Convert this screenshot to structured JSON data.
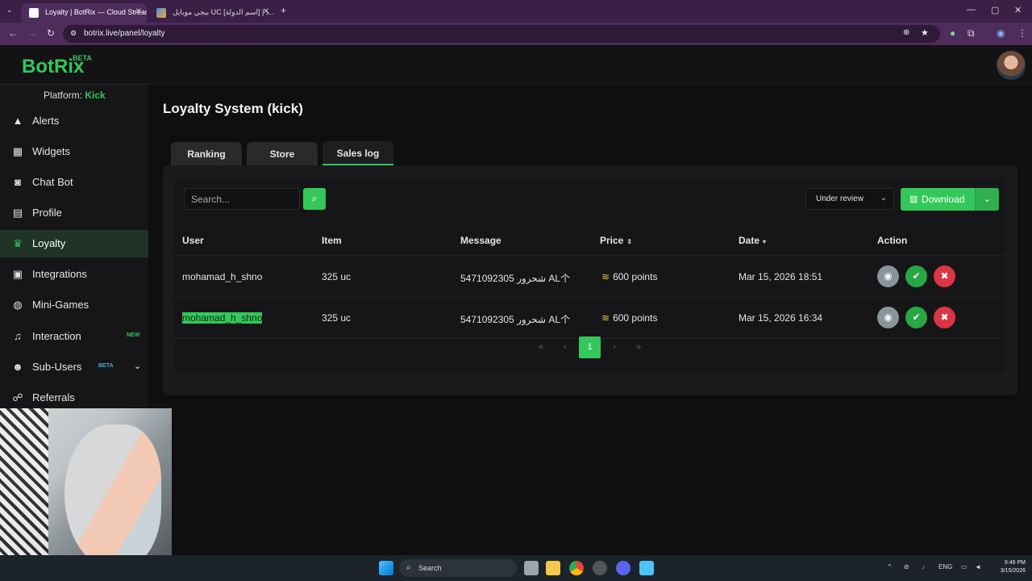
{
  "browser": {
    "tabs": [
      {
        "title": "Loyalty | BotRix — Cloud Stream"
      },
      {
        "title": "ببجي موبايل UC [اسم الدولة] | د..."
      }
    ],
    "url": "botrix.live/panel/loyalty"
  },
  "app": {
    "logo": "BotRix",
    "logo_badge": "BETA",
    "platform_label": "Platform:",
    "platform_value": "Kick"
  },
  "sidebar": {
    "items": [
      {
        "label": "Alerts",
        "icon": "warning-icon"
      },
      {
        "label": "Widgets",
        "icon": "grid-icon"
      },
      {
        "label": "Chat Bot",
        "icon": "robot-icon"
      },
      {
        "label": "Profile",
        "icon": "id-card-icon"
      },
      {
        "label": "Loyalty",
        "icon": "trophy-icon"
      },
      {
        "label": "Integrations",
        "icon": "integrations-icon"
      },
      {
        "label": "Mini-Games",
        "icon": "gamepad-icon"
      },
      {
        "label": "Interaction",
        "icon": "music-icon",
        "badge": "NEW"
      },
      {
        "label": "Sub-Users",
        "icon": "users-icon",
        "badge": "BETA"
      },
      {
        "label": "Referrals",
        "icon": "referrals-icon"
      }
    ]
  },
  "page": {
    "title": "Loyalty System (kick)",
    "tabs": [
      {
        "label": "Ranking"
      },
      {
        "label": "Store"
      },
      {
        "label": "Sales log"
      }
    ],
    "search_placeholder": "Search...",
    "filter_value": "Under review",
    "download_label": "Download"
  },
  "table": {
    "headers": [
      "User",
      "Item",
      "Message",
      "Price",
      "Date",
      "Action"
    ],
    "rows": [
      {
        "user": "mohamad_h_shno",
        "item": "325 uc",
        "message": "5471092305 شحرور AL个",
        "price": "600 points",
        "date": "Mar 15, 2026 18:51"
      },
      {
        "user": "mohamad_h_shno",
        "item": "325 uc",
        "message": "5471092305 شحرور AL个",
        "price": "600 points",
        "date": "Mar 15, 2026 16:34"
      }
    ]
  },
  "pagination": {
    "current": "1"
  },
  "taskbar": {
    "search": "Search",
    "lang": "ENG",
    "time": "9:46 PM",
    "date": "3/15/2026"
  }
}
